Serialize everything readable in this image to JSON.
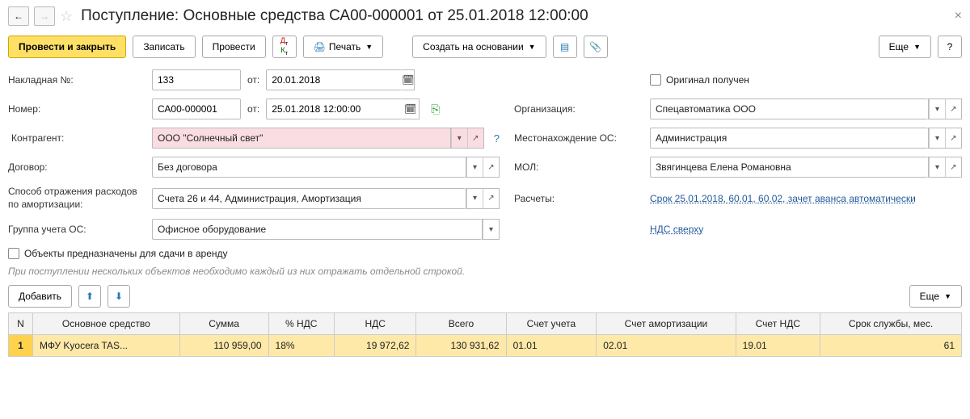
{
  "title": "Поступление: Основные средства СА00-000001 от 25.01.2018 12:00:00",
  "toolbar": {
    "post_close": "Провести и закрыть",
    "save": "Записать",
    "post": "Провести",
    "print": "Печать",
    "create_based": "Создать на основании",
    "more": "Еще"
  },
  "form": {
    "invoice_label": "Накладная №:",
    "invoice_no": "133",
    "from_label": "от:",
    "invoice_date": "20.01.2018",
    "original_received": "Оригинал получен",
    "number_label": "Номер:",
    "number": "СА00-000001",
    "number_date": "25.01.2018 12:00:00",
    "org_label": "Организация:",
    "org": "Спецавтоматика ООО",
    "counterparty_label": "Контрагент:",
    "counterparty": "ООО \"Солнечный свет\"",
    "location_label": "Местонахождение ОС:",
    "location": "Администрация",
    "contract_label": "Договор:",
    "contract": "Без договора",
    "mol_label": "МОЛ:",
    "mol": "Звягинцева Елена Романовна",
    "method_label": "Способ отражения расходов по амортизации:",
    "method": "Счета 26 и 44, Администрация, Амортизация",
    "calc_label": "Расчеты:",
    "calc_link": "Срок 25.01.2018, 60.01, 60.02, зачет аванса автоматически",
    "group_label": "Группа учета ОС:",
    "group": "Офисное оборудование",
    "vat_link": "НДС сверху",
    "rent_checkbox": "Объекты предназначены для сдачи в аренду"
  },
  "note": "При поступлении нескольких объектов необходимо каждый из них отражать отдельной строкой.",
  "table_toolbar": {
    "add": "Добавить",
    "more": "Еще"
  },
  "table": {
    "headers": {
      "n": "N",
      "asset": "Основное средство",
      "amount": "Сумма",
      "vat_pct": "% НДС",
      "vat": "НДС",
      "total": "Всего",
      "account": "Счет учета",
      "depr_account": "Счет амортизации",
      "vat_account": "Счет НДС",
      "lifetime": "Срок службы, мес."
    },
    "rows": [
      {
        "n": "1",
        "asset": "МФУ Kyocera TAS...",
        "amount": "110 959,00",
        "vat_pct": "18%",
        "vat": "19 972,62",
        "total": "130 931,62",
        "account": "01.01",
        "depr_account": "02.01",
        "vat_account": "19.01",
        "lifetime": "61"
      }
    ]
  }
}
